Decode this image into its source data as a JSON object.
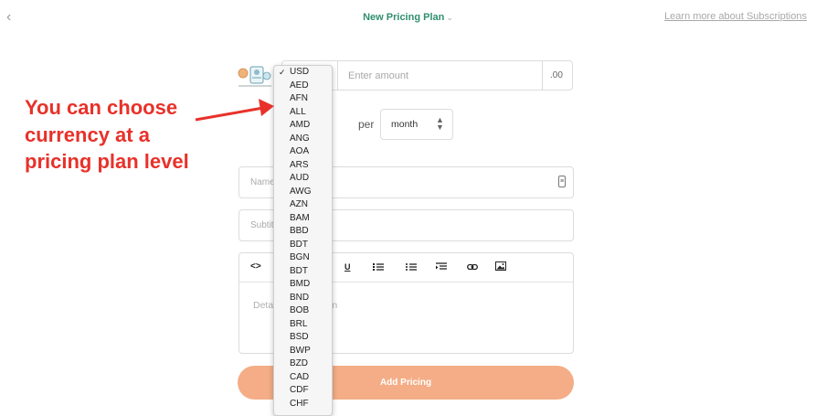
{
  "header": {
    "back_icon": "chevron-left-icon",
    "title": "New Pricing Plan",
    "learn_more": "Learn more about Subscriptions"
  },
  "amount": {
    "selected_currency": "USD",
    "placeholder": "Enter amount",
    "suffix": ".00"
  },
  "period": {
    "per_label": "per",
    "value": "month"
  },
  "fields": {
    "name_placeholder": "Name",
    "subtitle_placeholder": "Subtitle"
  },
  "editor": {
    "toolbar": {
      "code": "<>",
      "underline": "U"
    },
    "description_placeholder": "Detailed description"
  },
  "submit_label": "Add Pricing",
  "currency_options": [
    "USD",
    "AED",
    "AFN",
    "ALL",
    "AMD",
    "ANG",
    "AOA",
    "ARS",
    "AUD",
    "AWG",
    "AZN",
    "BAM",
    "BBD",
    "BDT",
    "BGN",
    "BDT",
    "BMD",
    "BND",
    "BOB",
    "BRL",
    "BSD",
    "BWP",
    "BZD",
    "CAD",
    "CDF",
    "CHF"
  ],
  "callout": {
    "line1": "You can choose",
    "line2": "currency at a",
    "line3": "pricing plan level"
  },
  "colors": {
    "accent_green": "#2f8f6e",
    "button": "#f4ad86",
    "callout_red": "#e8312a"
  }
}
